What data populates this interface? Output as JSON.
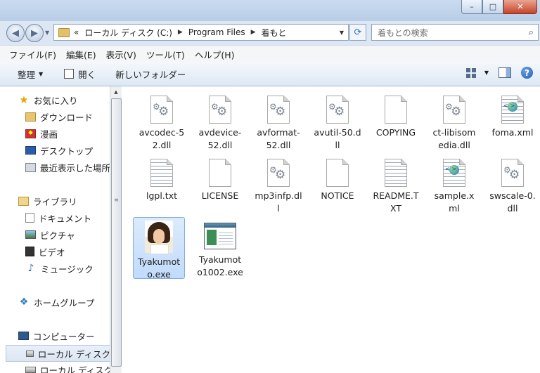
{
  "window": {
    "minimize": "–",
    "maximize": "□",
    "close": "✕"
  },
  "nav": {
    "back": "◀",
    "forward": "▶",
    "address": {
      "overflow": "«",
      "crumbs": [
        "ローカル ディスク (C:)",
        "Program Files",
        "着もと"
      ]
    },
    "search_placeholder": "着もとの検索"
  },
  "menu": [
    "ファイル(F)",
    "編集(E)",
    "表示(V)",
    "ツール(T)",
    "ヘルプ(H)"
  ],
  "toolbar": {
    "organize": "整理",
    "open": "開く",
    "new_folder": "新しいフォルダー"
  },
  "sidebar": {
    "favorites": {
      "label": "お気に入り",
      "items": [
        "ダウンロード",
        "漫画",
        "デスクトップ",
        "最近表示した場所"
      ]
    },
    "libraries": {
      "label": "ライブラリ",
      "items": [
        "ドキュメント",
        "ピクチャ",
        "ビデオ",
        "ミュージック"
      ]
    },
    "homegroup": "ホームグループ",
    "computer": {
      "label": "コンピューター",
      "items": [
        "ローカル ディスク",
        "ローカル ディスク"
      ]
    }
  },
  "files": [
    {
      "name": "avcodec-52.dll",
      "lines": [
        "avcodec-5",
        "2.dll"
      ],
      "type": "dll"
    },
    {
      "name": "avdevice-52.dll",
      "lines": [
        "avdevice-",
        "52.dll"
      ],
      "type": "dll"
    },
    {
      "name": "avformat-52.dll",
      "lines": [
        "avformat-",
        "52.dll"
      ],
      "type": "dll"
    },
    {
      "name": "avutil-50.dll",
      "lines": [
        "avutil-50.d",
        "ll"
      ],
      "type": "dll"
    },
    {
      "name": "COPYING",
      "lines": [
        "COPYING"
      ],
      "type": "blank"
    },
    {
      "name": "ct-libisomedia.dll",
      "lines": [
        "ct-libisom",
        "edia.dll"
      ],
      "type": "dll"
    },
    {
      "name": "foma.xml",
      "lines": [
        "foma.xml"
      ],
      "type": "xml"
    },
    {
      "name": "lgpl.txt",
      "lines": [
        "lgpl.txt"
      ],
      "type": "txt"
    },
    {
      "name": "LICENSE",
      "lines": [
        "LICENSE"
      ],
      "type": "blank"
    },
    {
      "name": "mp3infp.dll",
      "lines": [
        "mp3infp.dl",
        "l"
      ],
      "type": "dll"
    },
    {
      "name": "NOTICE",
      "lines": [
        "NOTICE"
      ],
      "type": "blank"
    },
    {
      "name": "README.TXT",
      "lines": [
        "README.T",
        "XT"
      ],
      "type": "txt"
    },
    {
      "name": "sample.xml",
      "lines": [
        "sample.x",
        "ml"
      ],
      "type": "xml"
    },
    {
      "name": "swscale-0.dll",
      "lines": [
        "swscale-0.",
        "dll"
      ],
      "type": "dll"
    },
    {
      "name": "Tyakumoto.exe",
      "lines": [
        "Tyakumot",
        "o.exe"
      ],
      "type": "photo",
      "selected": true
    },
    {
      "name": "Tyakumoto1002.exe",
      "lines": [
        "Tyakumot",
        "o1002.exe"
      ],
      "type": "app"
    }
  ]
}
